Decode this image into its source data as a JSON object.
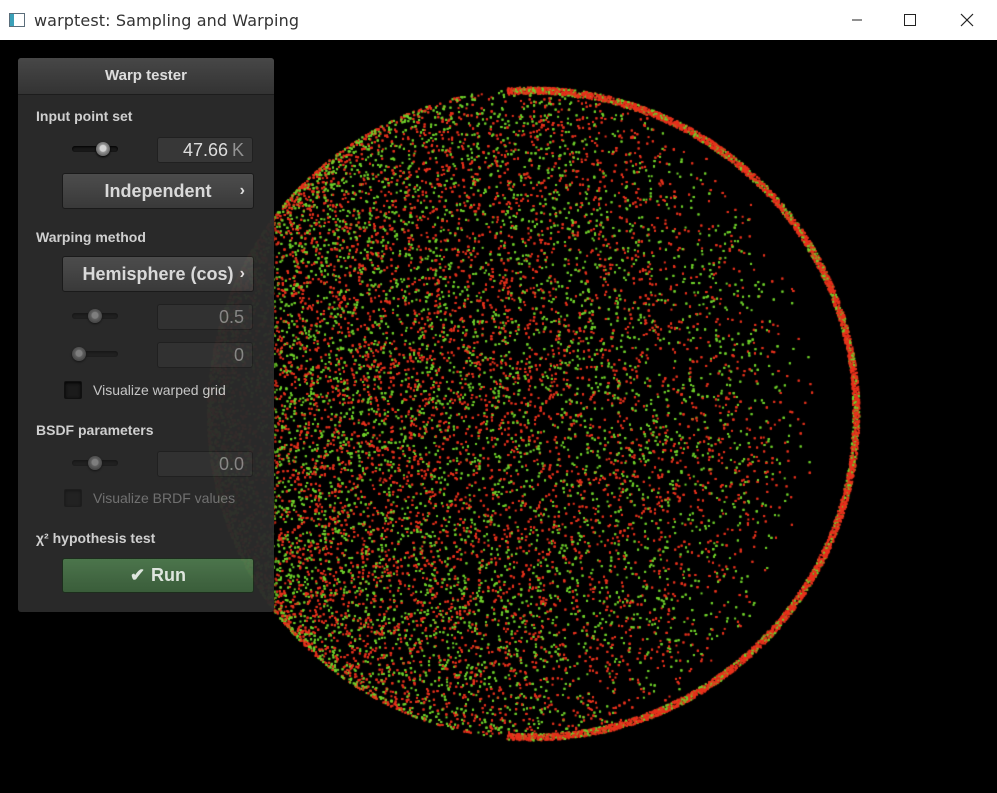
{
  "window": {
    "title": "warptest: Sampling and Warping"
  },
  "panel": {
    "title": "Warp tester",
    "input_point_set": {
      "label": "Input point set",
      "slider_level": 0.75,
      "value": "47.66",
      "unit": "K",
      "dropdown": "Independent"
    },
    "warping_method": {
      "label": "Warping method",
      "dropdown": "Hemisphere (cos)",
      "param1_slider_level": 0.5,
      "param1_value": "0.5",
      "param2_slider_level": 0.0,
      "param2_value": "0",
      "visualize_grid_label": "Visualize warped grid",
      "visualize_grid_checked": false
    },
    "bsdf": {
      "label": "BSDF parameters",
      "slider_level": 0.5,
      "value": "0.0",
      "visualize_brdf_label": "Visualize BRDF values",
      "visualize_brdf_checked": false
    },
    "chi2": {
      "label": "χ² hypothesis test",
      "run_label": "Run"
    }
  },
  "colors": {
    "point_red": "#e8311c",
    "point_green": "#6fd12a",
    "run_button": "#46704a"
  },
  "icons": {
    "chevron": "chevron-right-icon",
    "check": "check-icon",
    "minimize": "minimize-icon",
    "maximize": "maximize-icon",
    "close": "close-icon"
  }
}
